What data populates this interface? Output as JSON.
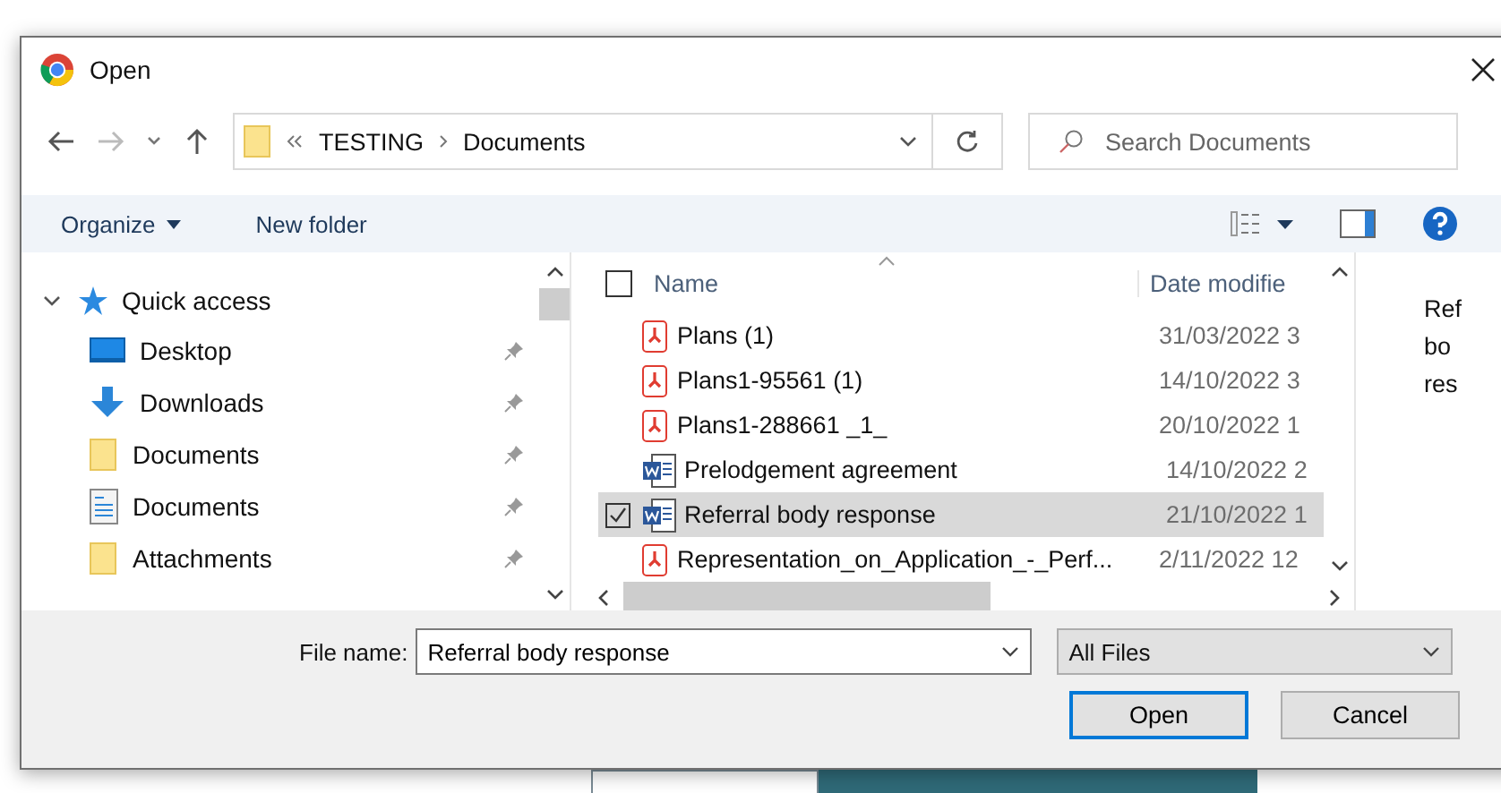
{
  "window": {
    "title": "Open"
  },
  "address": {
    "path": [
      {
        "label": "TESTING"
      },
      {
        "label": "Documents"
      }
    ]
  },
  "search": {
    "placeholder": "Search Documents"
  },
  "toolbar": {
    "organize": "Organize",
    "new_folder": "New folder"
  },
  "nav": {
    "label": "Quick access",
    "expanded": true,
    "children": [
      {
        "label": "Desktop",
        "kind": "desktop",
        "pinned": true
      },
      {
        "label": "Downloads",
        "kind": "downloads",
        "pinned": true
      },
      {
        "label": "Documents",
        "kind": "folder",
        "pinned": true
      },
      {
        "label": "Documents",
        "kind": "docs",
        "pinned": true
      },
      {
        "label": "Attachments",
        "kind": "folder",
        "pinned": true
      }
    ]
  },
  "columns": [
    "Name",
    "Date modifie"
  ],
  "all_checked": false,
  "files": [
    {
      "name": "Plans (1)",
      "date": "31/03/2022 3",
      "kind": "pdf",
      "selected": false,
      "checked": false
    },
    {
      "name": "Plans1-95561 (1)",
      "date": "14/10/2022 3",
      "kind": "pdf",
      "selected": false,
      "checked": false
    },
    {
      "name": "Plans1-288661 _1_",
      "date": "20/10/2022 1",
      "kind": "pdf",
      "selected": false,
      "checked": false
    },
    {
      "name": "Prelodgement agreement",
      "date": "14/10/2022 2",
      "kind": "word",
      "selected": false,
      "checked": false
    },
    {
      "name": "Referral body response",
      "date": "21/10/2022 1",
      "kind": "word",
      "selected": true,
      "checked": true
    },
    {
      "name": "Representation_on_Application_-_Perf...",
      "date": "2/11/2022 12",
      "kind": "pdf",
      "selected": false,
      "checked": false
    }
  ],
  "preview": [
    "Ref",
    "bo",
    "res"
  ],
  "file_name": {
    "label": "File name:",
    "value": "Referral body response"
  },
  "filter": "All Files",
  "buttons": [
    {
      "label": "Open",
      "default": true
    },
    {
      "label": "Cancel",
      "default": false
    }
  ]
}
